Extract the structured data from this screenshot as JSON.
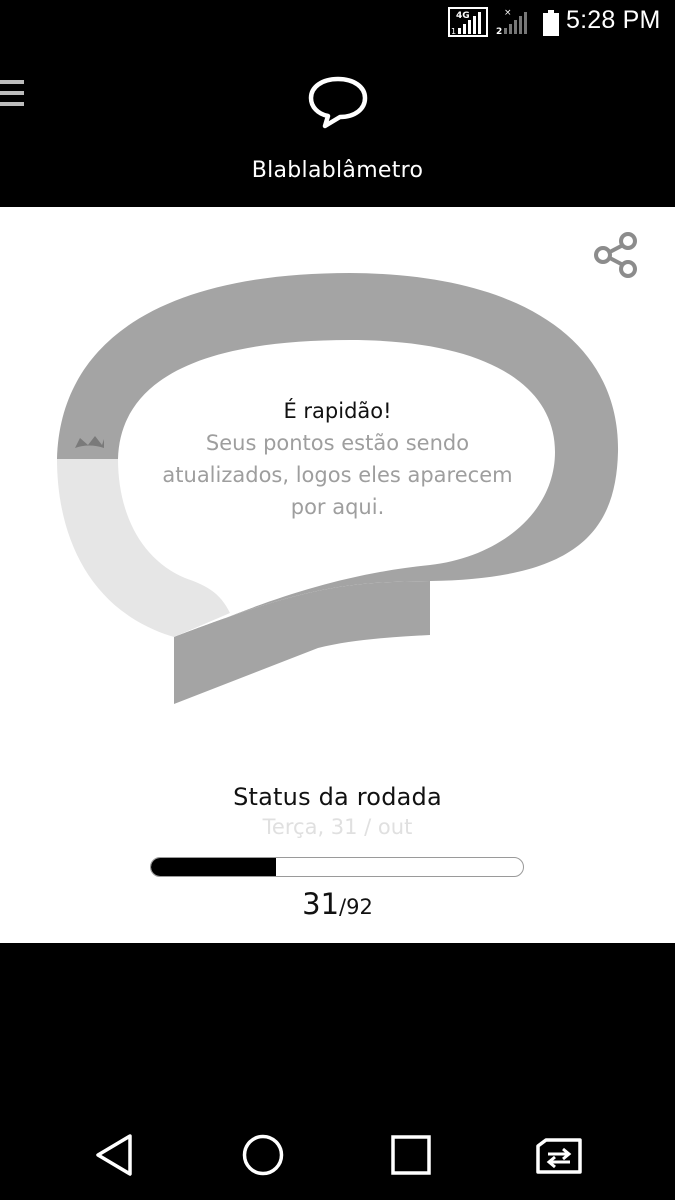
{
  "status_bar": {
    "network_label": "4G",
    "sim1_label": "1",
    "sim2_label": "2",
    "time": "5:28 PM"
  },
  "header": {
    "menu_icon": "hamburger-menu-icon",
    "logo_icon": "speech-bubble-icon",
    "title": "Blablablâmetro"
  },
  "card": {
    "share_icon": "share-icon",
    "meter": {
      "heading": "É rapidão!",
      "message": "Seus pontos estão sendo atualizados, logos eles aparecem por aqui.",
      "marker_icon": "crown-icon"
    },
    "round_status": {
      "title": "Status da rodada",
      "date": "Terça, 31 / out",
      "current": "31",
      "total": "/92",
      "progress_fraction": 0.3369
    }
  },
  "nav_bar": {
    "back_icon": "back-triangle-icon",
    "home_icon": "home-circle-icon",
    "recents_icon": "recents-square-icon",
    "switch_icon": "sim-switch-icon"
  },
  "colors": {
    "header_bg": "#000000",
    "card_bg": "#ffffff",
    "meter_filled": "#a4a4a4",
    "meter_empty": "#e6e6e6",
    "progress_fill": "#000000"
  }
}
